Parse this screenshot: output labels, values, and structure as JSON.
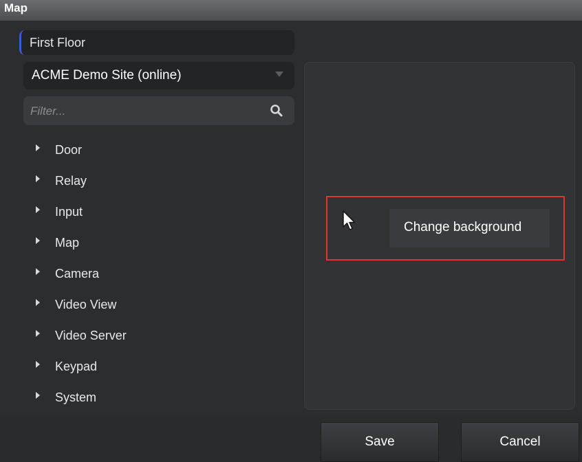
{
  "window": {
    "title": "Map"
  },
  "map": {
    "name": "First Floor"
  },
  "site_selector": {
    "selected": "ACME Demo Site (online)"
  },
  "filter": {
    "placeholder": "Filter..."
  },
  "tree": {
    "items": [
      {
        "label": "Door"
      },
      {
        "label": "Relay"
      },
      {
        "label": "Input"
      },
      {
        "label": "Map"
      },
      {
        "label": "Camera"
      },
      {
        "label": "Video View"
      },
      {
        "label": "Video Server"
      },
      {
        "label": "Keypad"
      },
      {
        "label": "System"
      }
    ]
  },
  "context_menu": {
    "item_label": "Change background"
  },
  "footer": {
    "save_label": "Save",
    "cancel_label": "Cancel"
  },
  "colors": {
    "highlight": "#e03535",
    "focus_accent": "#3e5bd6"
  }
}
